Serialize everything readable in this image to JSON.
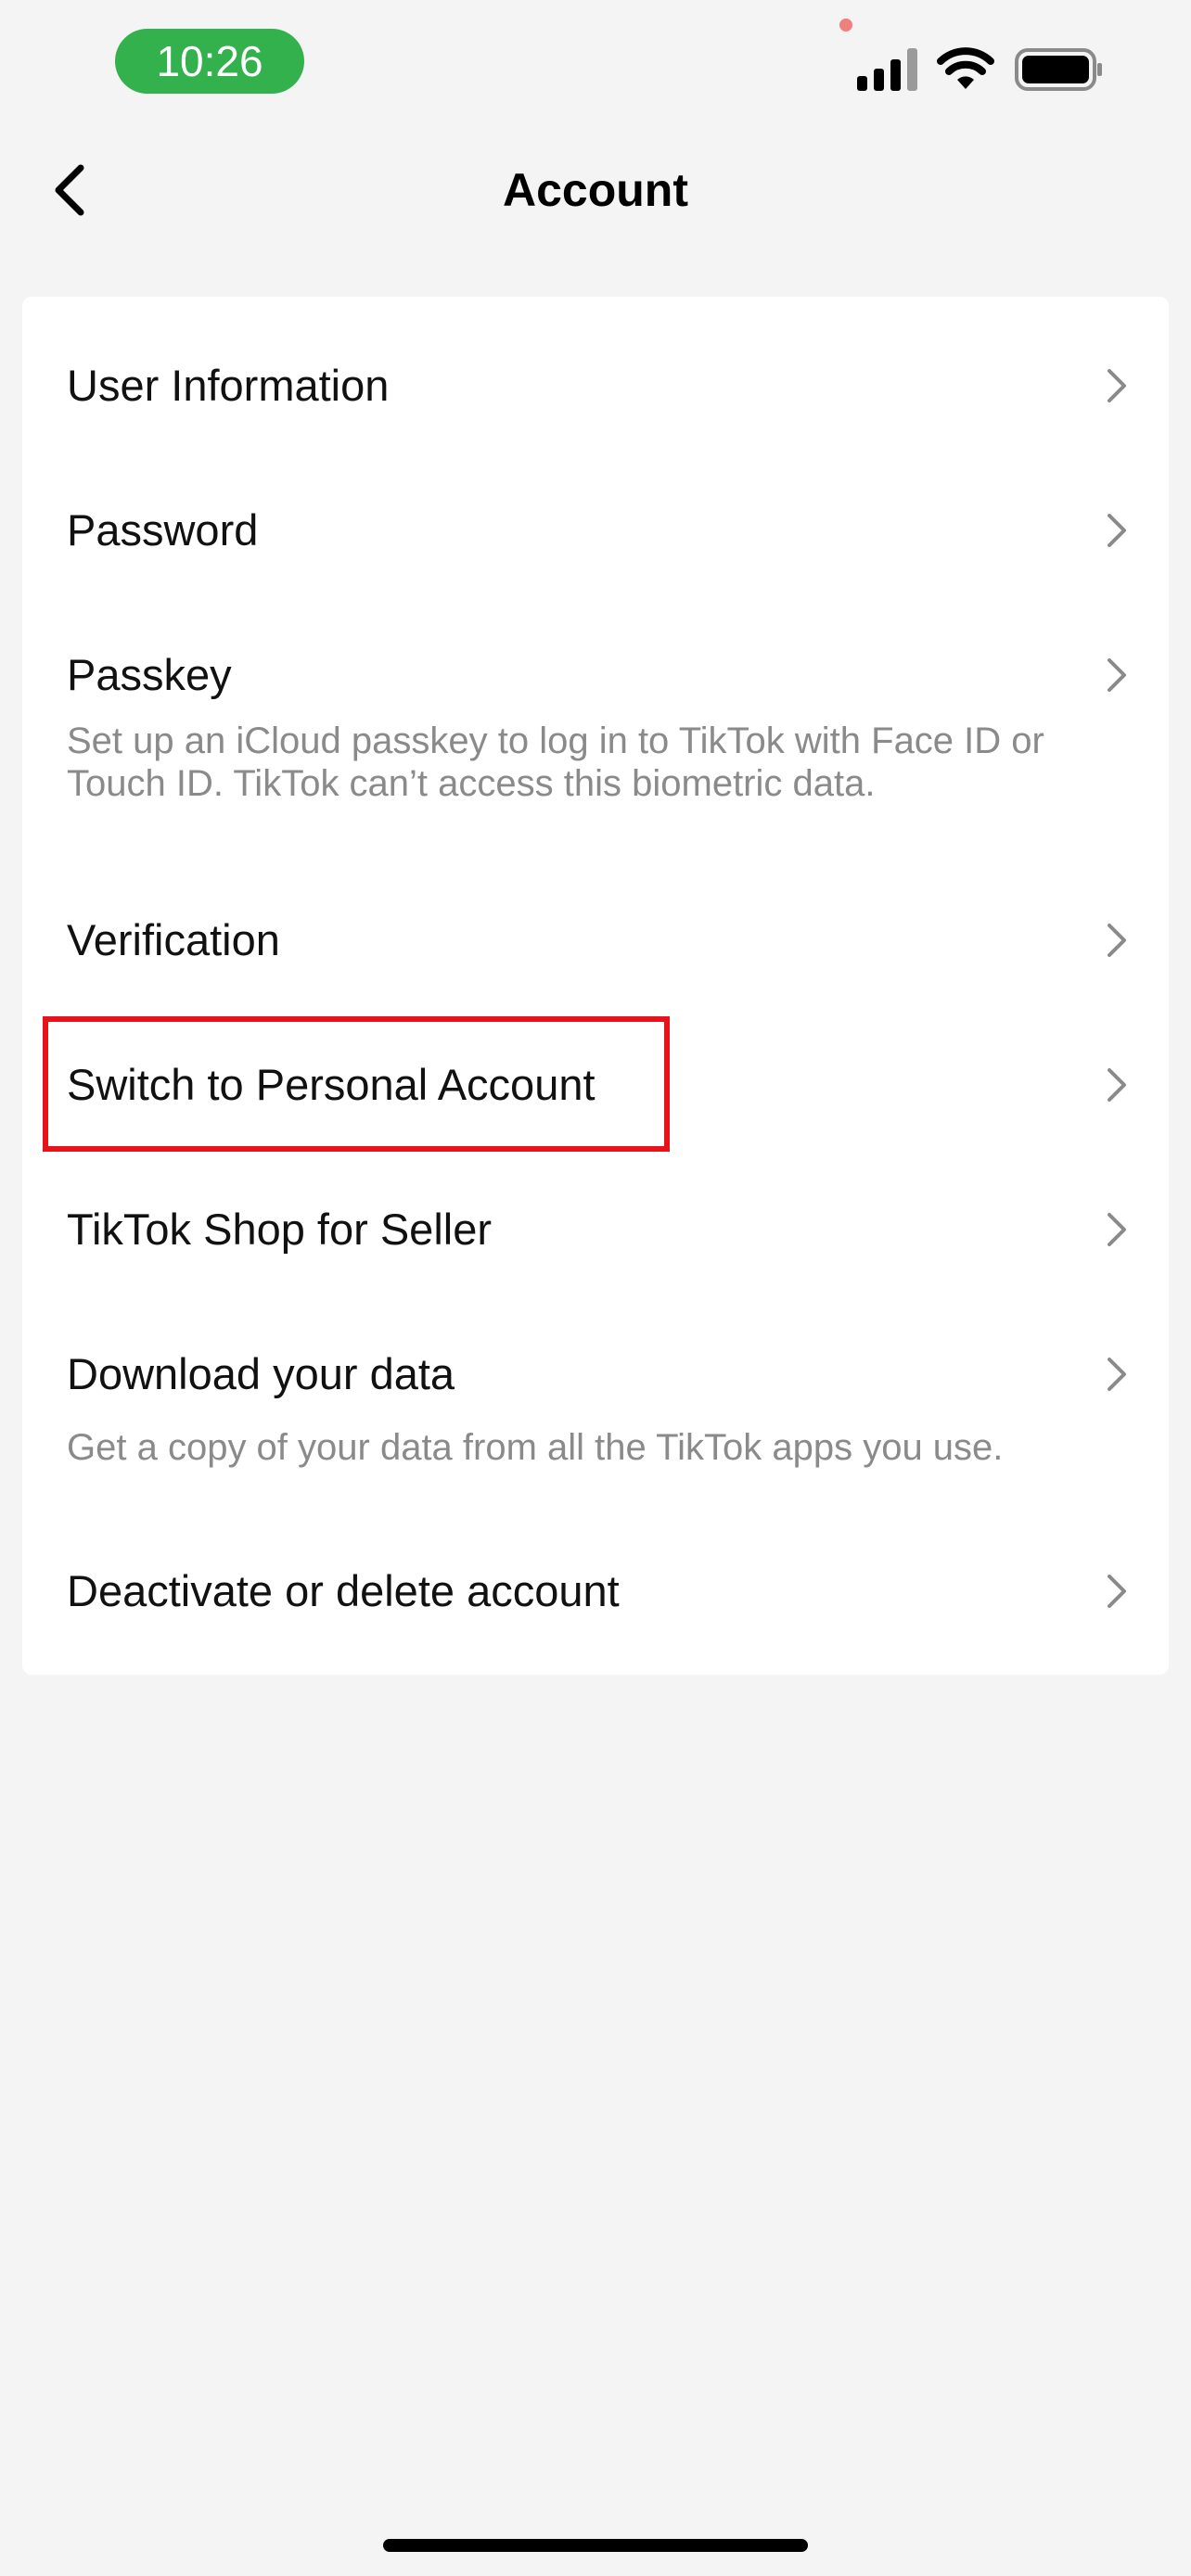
{
  "status_bar": {
    "time": "10:26",
    "icons": [
      "signal-icon",
      "wifi-icon",
      "battery-icon"
    ],
    "accent_color": "#33b14d"
  },
  "header": {
    "title": "Account",
    "back_icon": "chevron-left-icon"
  },
  "menu": [
    {
      "label": "User Information"
    },
    {
      "label": "Password"
    },
    {
      "label": "Passkey",
      "description": "Set up an iCloud passkey to log in to TikTok with Face ID or Touch ID. TikTok can’t access this biometric data."
    },
    {
      "label": "Verification"
    },
    {
      "label": "Switch to Personal Account",
      "highlighted": true
    },
    {
      "label": "TikTok Shop for Seller"
    },
    {
      "label": "Download your data",
      "description": "Get a copy of your data from all the TikTok apps you use."
    },
    {
      "label": "Deactivate or delete account"
    }
  ],
  "highlight_color": "#e8121a"
}
